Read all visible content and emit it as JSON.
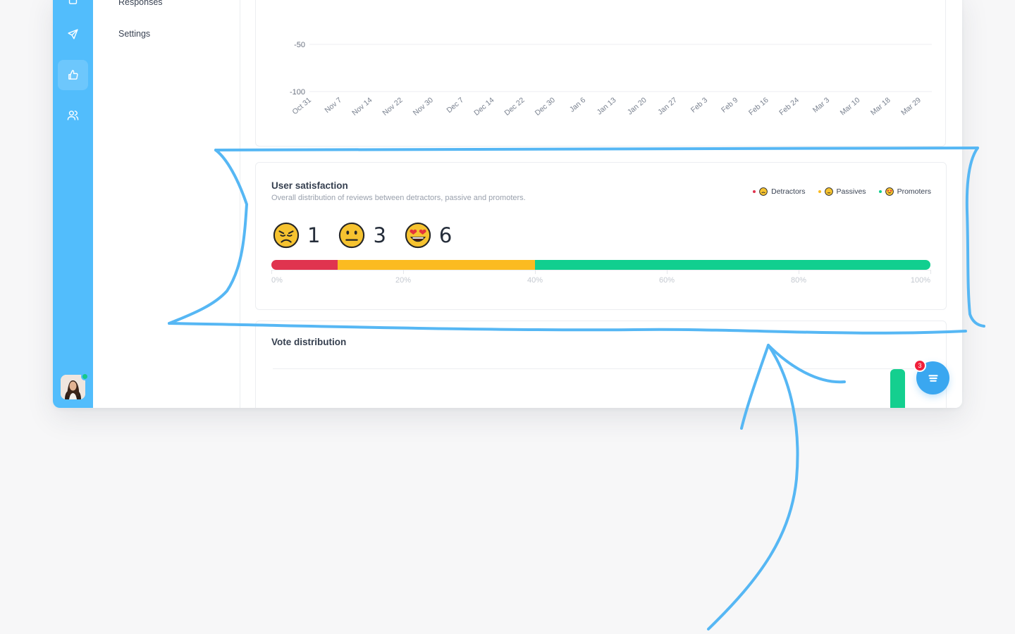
{
  "sidebar": {
    "items": [
      {
        "label": "Responses"
      },
      {
        "label": "Settings"
      }
    ]
  },
  "icon_rail": {
    "items": [
      "send-icon",
      "thumbs-up-icon",
      "users-icon"
    ],
    "active": "thumbs-up-icon",
    "color": "#52bdfc"
  },
  "chart": {
    "y_ticks": [
      "-50",
      "-100"
    ],
    "x_ticks": [
      "Oct 31",
      "Nov 7",
      "Nov 14",
      "Nov 22",
      "Nov 30",
      "Dec 7",
      "Dec 14",
      "Dec 22",
      "Dec 30",
      "Jan 6",
      "Jan 13",
      "Jan 20",
      "Jan 27",
      "Feb 3",
      "Feb 9",
      "Feb 16",
      "Feb 24",
      "Mar 3",
      "Mar 10",
      "Mar 18",
      "Mar 29"
    ]
  },
  "satisfaction": {
    "title": "User satisfaction",
    "subtitle": "Overall distribution of reviews between detractors, passive and promoters.",
    "legend": [
      {
        "label": "Detractors",
        "color": "#e0344f"
      },
      {
        "label": "Passives",
        "color": "#fbbb21"
      },
      {
        "label": "Promoters",
        "color": "#11cf8f"
      }
    ],
    "scores": [
      {
        "name": "detractors",
        "value": "1",
        "icon": "sad-face-icon"
      },
      {
        "name": "passives",
        "value": "3",
        "icon": "neutral-face-icon"
      },
      {
        "name": "promoters",
        "value": "6",
        "icon": "heart-eyes-face-icon"
      }
    ],
    "distribution": [
      {
        "name": "detractors",
        "fraction": 0.1,
        "color": "#e0344f"
      },
      {
        "name": "passives",
        "fraction": 0.3,
        "color": "#fbbb21"
      },
      {
        "name": "promoters",
        "fraction": 0.6,
        "color": "#11cf8f"
      }
    ],
    "scale_labels": [
      "0%",
      "20%",
      "40%",
      "60%",
      "80%",
      "100%"
    ]
  },
  "vote_distribution": {
    "title": "Vote distribution"
  },
  "chat": {
    "badge_count": "3"
  }
}
